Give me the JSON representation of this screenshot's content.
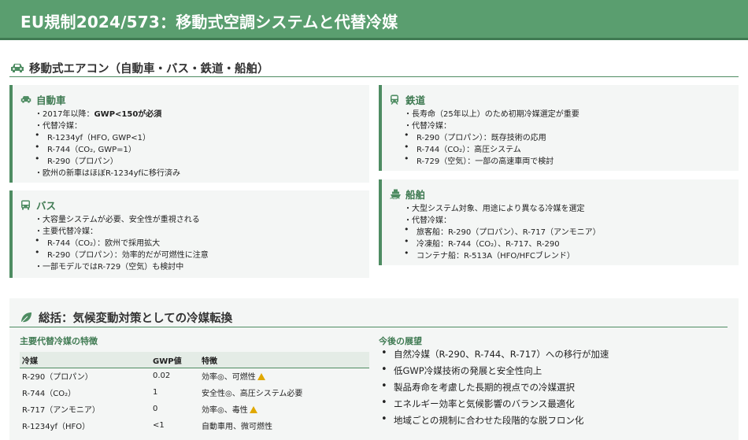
{
  "page": {
    "title": "EU規制2024/573：移動式空調システムと代替冷媒"
  },
  "mobile_ac": {
    "title": "移動式エアコン（自動車・バス・鉄道・船舶）",
    "icon": "car-icon"
  },
  "cards": {
    "car": {
      "title": "自動車",
      "icon": "car-icon",
      "l1_prefix": "・2017年以降：",
      "l1_bold": "GWP<150が必須",
      "l2": "・代替冷媒：",
      "l3": "R-1234yf（HFO, GWP<1）",
      "l4": "R-744（CO₂, GWP=1）",
      "l5": "R-290（プロパン）",
      "l6": "・欧州の新車はほぼR-1234yfに移行済み"
    },
    "bus": {
      "title": "バス",
      "icon": "bus-icon",
      "l1": "・大容量システムが必要、安全性が重視される",
      "l2": "・主要代替冷媒：",
      "l3": "R-744（CO₂）：欧州で採用拡大",
      "l4": "R-290（プロパン）：効率的だが可燃性に注意",
      "l5": "・一部モデルではR-729（空気）も検討中"
    },
    "rail": {
      "title": "鉄道",
      "icon": "train-icon",
      "l1": "・長寿命（25年以上）のため初期冷媒選定が重要",
      "l2": "・代替冷媒：",
      "l3": "R-290（プロパン）：既存技術の応用",
      "l4": "R-744（CO₂）：高圧システム",
      "l5": "R-729（空気）：一部の高速車両で検討"
    },
    "ship": {
      "title": "船舶",
      "icon": "ship-icon",
      "l1": "・大型システム対象、用途により異なる冷媒を選定",
      "l2": "・代替冷媒：",
      "l3": "旅客船：R-290（プロパン）、R-717（アンモニア）",
      "l4": "冷凍船：R-744（CO₂）、R-717、R-290",
      "l5": "コンテナ船：R-513A（HFO/HFCブレンド）"
    }
  },
  "summary": {
    "title": "総括：気候変動対策としての冷媒転換",
    "icon": "leaf-icon",
    "table_title": "主要代替冷媒の特徴",
    "columns": [
      "冷媒",
      "GWP値",
      "特徴"
    ],
    "rows": [
      {
        "name": "R-290（プロパン）",
        "gwp": "0.02",
        "feature": "効率◎、可燃性",
        "warn": true
      },
      {
        "name": "R-744（CO₂）",
        "gwp": "1",
        "feature": "安全性◎、高圧システム必要",
        "warn": false
      },
      {
        "name": "R-717（アンモニア）",
        "gwp": "0",
        "feature": "効率◎、毒性",
        "warn": true
      },
      {
        "name": "R-1234yf（HFO）",
        "gwp": "<1",
        "feature": "自動車用、微可燃性",
        "warn": false
      }
    ],
    "outlook_title": "今後の展望",
    "outlook": [
      "自然冷媒（R-290、R-744、R-717）への移行が加速",
      "低GWP冷媒技術の発展と安全性向上",
      "製品寿命を考慮した長期的視点での冷媒選択",
      "エネルギー効率と気候影響のバランス最適化",
      "地域ごとの規制に合わせた段階的な脱フロン化"
    ]
  }
}
